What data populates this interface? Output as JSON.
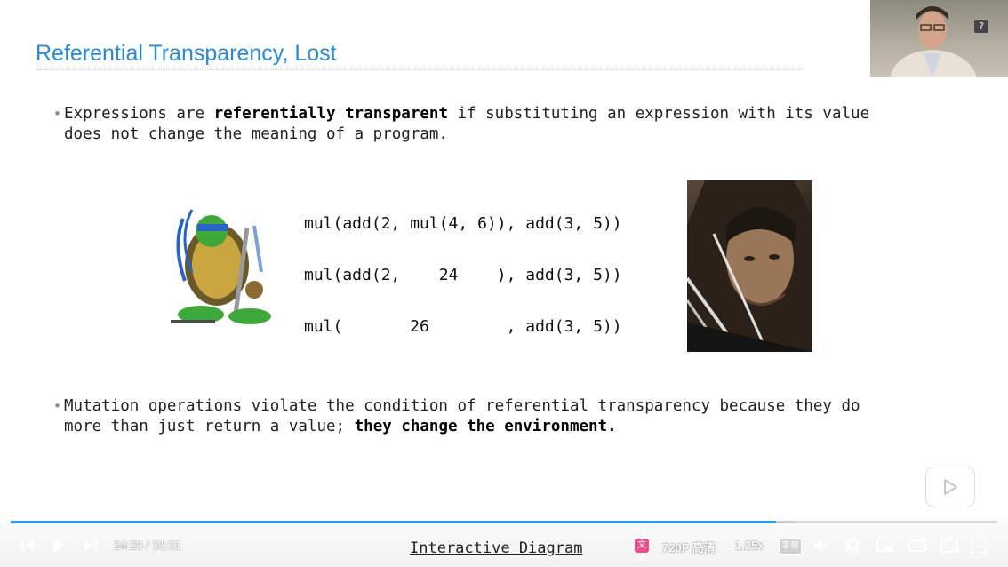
{
  "slide": {
    "title": "Referential Transparency, Lost",
    "bullet1": {
      "pre": "Expressions are ",
      "bold": "referentially transparent",
      "post_line1": " if substituting an expression with its value",
      "line2": "does not change the meaning of a program."
    },
    "expressions": [
      "mul(add(2, mul(4, 6)), add(3, 5))",
      "mul(add(2,    24    ), add(3, 5))",
      "mul(       26        , add(3, 5))"
    ],
    "bullet2": {
      "line1": "Mutation operations violate the condition of referential transparency because they do",
      "line2_pre": "more than just return a value; ",
      "line2_bold": "they change the environment."
    }
  },
  "overlay": {
    "help_badge": "?"
  },
  "player": {
    "time_current": "24:29",
    "time_separator": " / ",
    "time_total": "31:31",
    "progress_fraction": 0.776,
    "buffer_fraction": 0.795,
    "caption": "Interactive Diagram",
    "translate_badge": "文A",
    "quality": "720P 高清",
    "speed": "1.25x",
    "subtitle_badge": "字幕",
    "accent": "#2e9bf0",
    "icons": [
      "skip-back-icon",
      "play-icon",
      "skip-forward-icon",
      "translate-icon",
      "subtitle-icon",
      "volume-icon",
      "gear-icon",
      "pip-icon",
      "widescreen-icon",
      "fullscreen-icon",
      "web-fullscreen-icon",
      "big-play-icon"
    ]
  }
}
